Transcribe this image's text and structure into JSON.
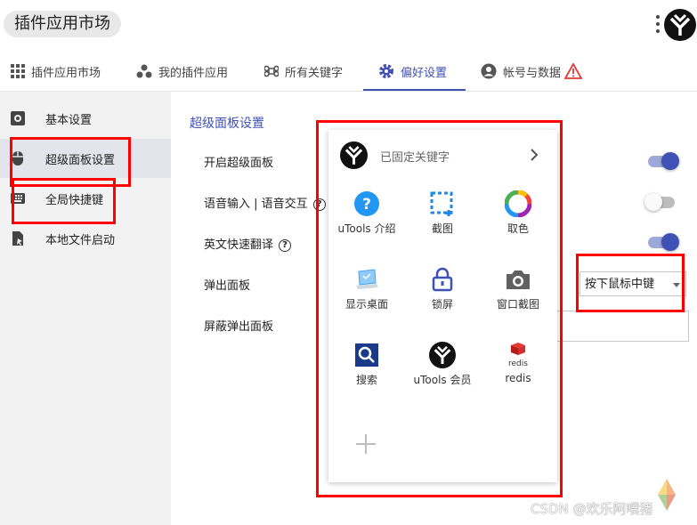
{
  "top": {
    "title": "插件应用市场"
  },
  "tabs": [
    {
      "label": "插件应用市场",
      "icon": "grid-icon"
    },
    {
      "label": "我的插件应用",
      "icon": "dots-cluster-icon"
    },
    {
      "label": "所有关键字",
      "icon": "command-icon"
    },
    {
      "label": "偏好设置",
      "icon": "gear-icon",
      "active": true
    },
    {
      "label": "帐号与数据",
      "icon": "account-icon",
      "warning": "warning-icon"
    }
  ],
  "sidebar": {
    "items": [
      {
        "label": "基本设置",
        "icon": "gear-box-icon"
      },
      {
        "label": "超级面板设置",
        "icon": "mouse-icon",
        "selected": true
      },
      {
        "label": "全局快捷键",
        "icon": "keyboard-icon"
      },
      {
        "label": "本地文件启动",
        "icon": "file-launch-icon"
      }
    ]
  },
  "settings": {
    "section_title": "超级面板设置",
    "rows": [
      {
        "label": "开启超级面板",
        "control": "toggle",
        "on": true
      },
      {
        "label": "语音输入 | 语音交互",
        "help": "?",
        "control": "toggle",
        "on": false
      },
      {
        "label": "英文快速翻译",
        "help": "?",
        "control": "toggle",
        "on": true
      },
      {
        "label": "弹出面板",
        "control": "select",
        "value": "按下鼠标中键"
      },
      {
        "label": "屏蔽弹出面板",
        "control": "input",
        "value": ""
      }
    ]
  },
  "panel": {
    "title": "已固定关键字",
    "items": [
      {
        "label": "uTools 介绍",
        "icon": "help-circle-icon"
      },
      {
        "label": "截图",
        "icon": "screenshot-icon"
      },
      {
        "label": "取色",
        "icon": "color-wheel-icon"
      },
      {
        "label": "显示桌面",
        "icon": "laptop-icon"
      },
      {
        "label": "锁屏",
        "icon": "lock-icon"
      },
      {
        "label": "窗口截图",
        "icon": "camera-icon"
      },
      {
        "label": "搜索",
        "icon": "search-icon"
      },
      {
        "label": "uTools 会员",
        "icon": "utools-logo-icon"
      },
      {
        "label": "redis",
        "icon": "redis-icon",
        "icon_text": "redis"
      }
    ],
    "add_icon": "plus-icon"
  },
  "watermark": {
    "text": "CSDN @欢乐阿噗猪"
  },
  "colors": {
    "accent": "#3f51b5",
    "highlight": "#ff0000",
    "blue_icon": "#2196f3"
  }
}
